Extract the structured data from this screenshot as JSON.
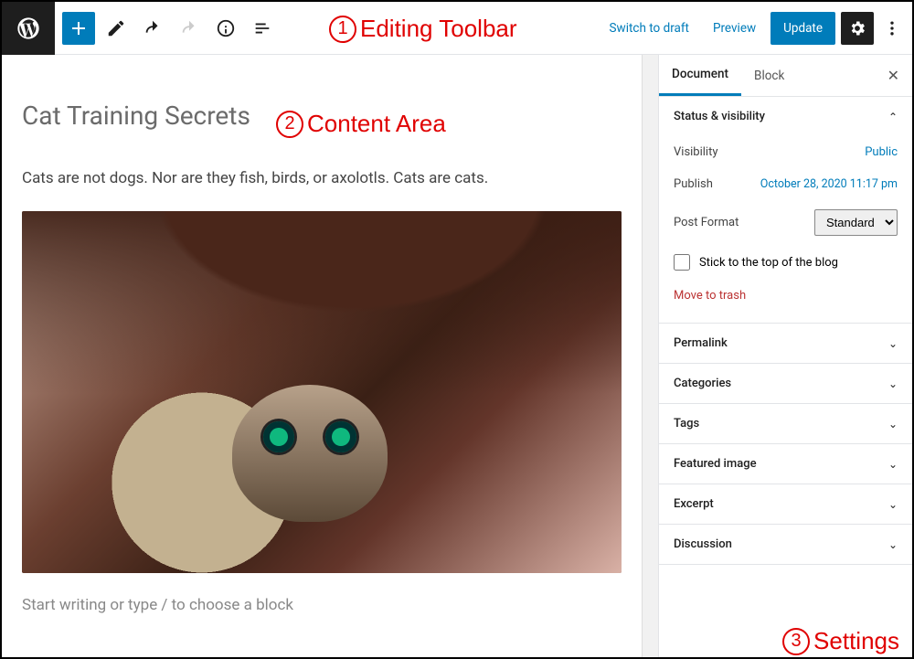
{
  "toolbar": {
    "switch_to_draft": "Switch to draft",
    "preview": "Preview",
    "update": "Update"
  },
  "annotations": {
    "a1": "Editing Toolbar",
    "a2": "Content Area",
    "a3": "Settings"
  },
  "content": {
    "title": "Cat Training Secrets",
    "paragraph": "Cats are not dogs. Nor are they fish, birds, or axolotls. Cats are cats.",
    "placeholder": "Start writing or type / to choose a block"
  },
  "sidebar": {
    "tabs": {
      "document": "Document",
      "block": "Block"
    },
    "status": {
      "heading": "Status & visibility",
      "visibility_label": "Visibility",
      "visibility_value": "Public",
      "publish_label": "Publish",
      "publish_value": "October 28, 2020 11:17 pm",
      "post_format_label": "Post Format",
      "post_format_value": "Standard",
      "sticky_label": "Stick to the top of the blog",
      "trash": "Move to trash"
    },
    "panels": {
      "permalink": "Permalink",
      "categories": "Categories",
      "tags": "Tags",
      "featured_image": "Featured image",
      "excerpt": "Excerpt",
      "discussion": "Discussion"
    }
  }
}
